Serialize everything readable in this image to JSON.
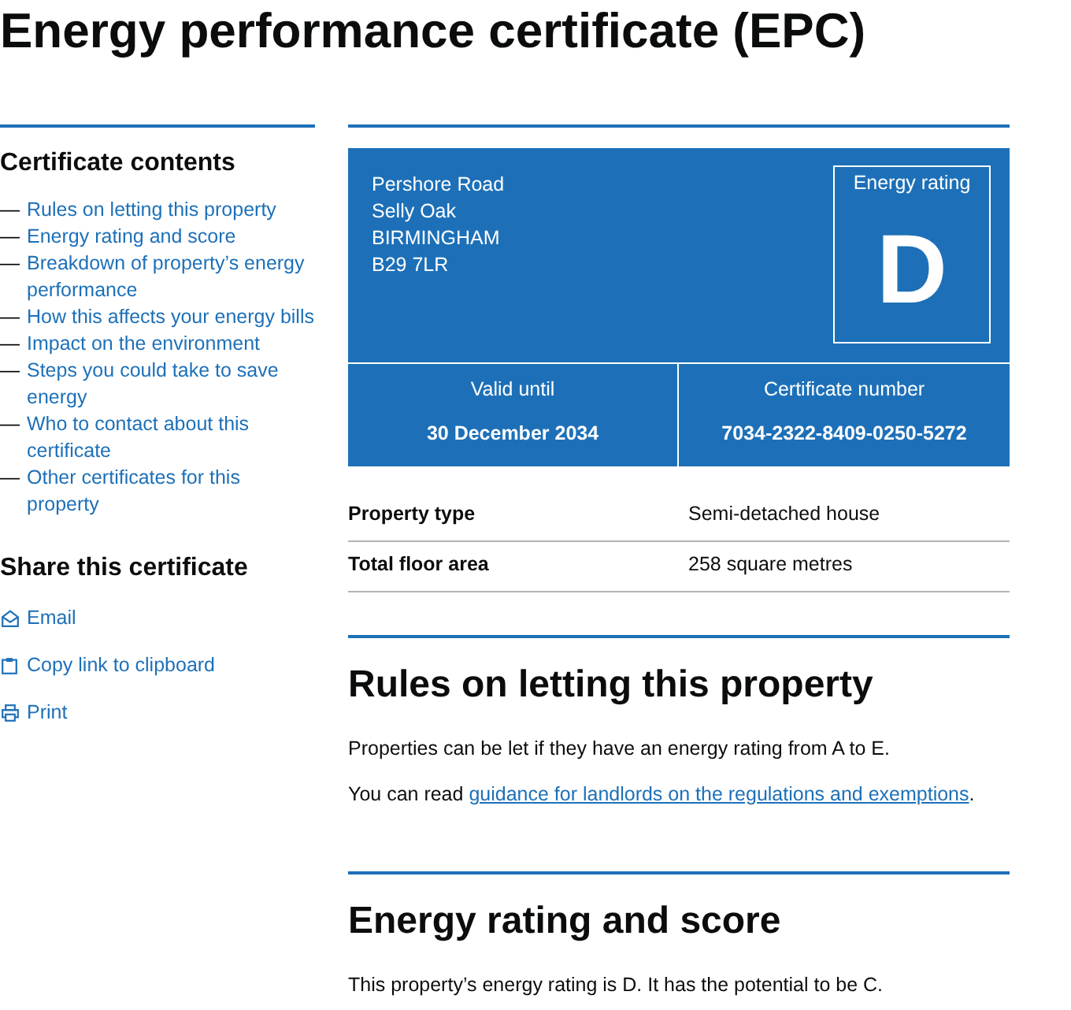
{
  "page": {
    "title": "Energy performance certificate (EPC)"
  },
  "contents": {
    "heading": "Certificate contents",
    "items": [
      {
        "marker": "—",
        "label": "Rules on letting this property"
      },
      {
        "marker": "—",
        "label": "Energy rating and score"
      },
      {
        "marker": "—",
        "label": "Breakdown of property’s energy performance"
      },
      {
        "marker": "—",
        "label": "How this affects your energy bills"
      },
      {
        "marker": "—",
        "label": "Impact on the environment"
      },
      {
        "marker": "—",
        "label": "Steps you could take to save energy"
      },
      {
        "marker": "—",
        "label": "Who to contact about this certificate"
      },
      {
        "marker": "—",
        "label": "Other certificates for this property"
      }
    ]
  },
  "share": {
    "heading": "Share this certificate",
    "items": [
      {
        "kind": "email",
        "label": "Email"
      },
      {
        "kind": "copy",
        "label": "Copy link to clipboard"
      },
      {
        "kind": "print",
        "label": "Print"
      }
    ]
  },
  "summary": {
    "address": [
      "Pershore Road",
      "Selly Oak",
      "BIRMINGHAM",
      "B29 7LR"
    ],
    "rating": {
      "label": "Energy rating",
      "value": "D"
    },
    "facts": [
      {
        "label": "Valid until",
        "value": "30 December 2034"
      },
      {
        "label": "Certificate number",
        "value": "7034-2322-8409-0250-5272"
      }
    ]
  },
  "property_details": [
    {
      "label": "Property type",
      "value": "Semi-detached house"
    },
    {
      "label": "Total floor area",
      "value": "258 square metres"
    }
  ],
  "sections": [
    {
      "heading": "Rules on letting this property",
      "paragraphs": [
        [
          {
            "kind": "text",
            "text": "Properties can be let if they have an energy rating from A to E."
          }
        ],
        [
          {
            "kind": "text",
            "text": "You can read "
          },
          {
            "kind": "link",
            "text": "guidance for landlords on the regulations and exemptions"
          },
          {
            "kind": "text",
            "text": "."
          }
        ]
      ]
    },
    {
      "heading": "Energy rating and score",
      "paragraphs": [
        [
          {
            "kind": "text",
            "text": "This property’s energy rating is D. It has the potential to be C."
          }
        ]
      ]
    }
  ]
}
